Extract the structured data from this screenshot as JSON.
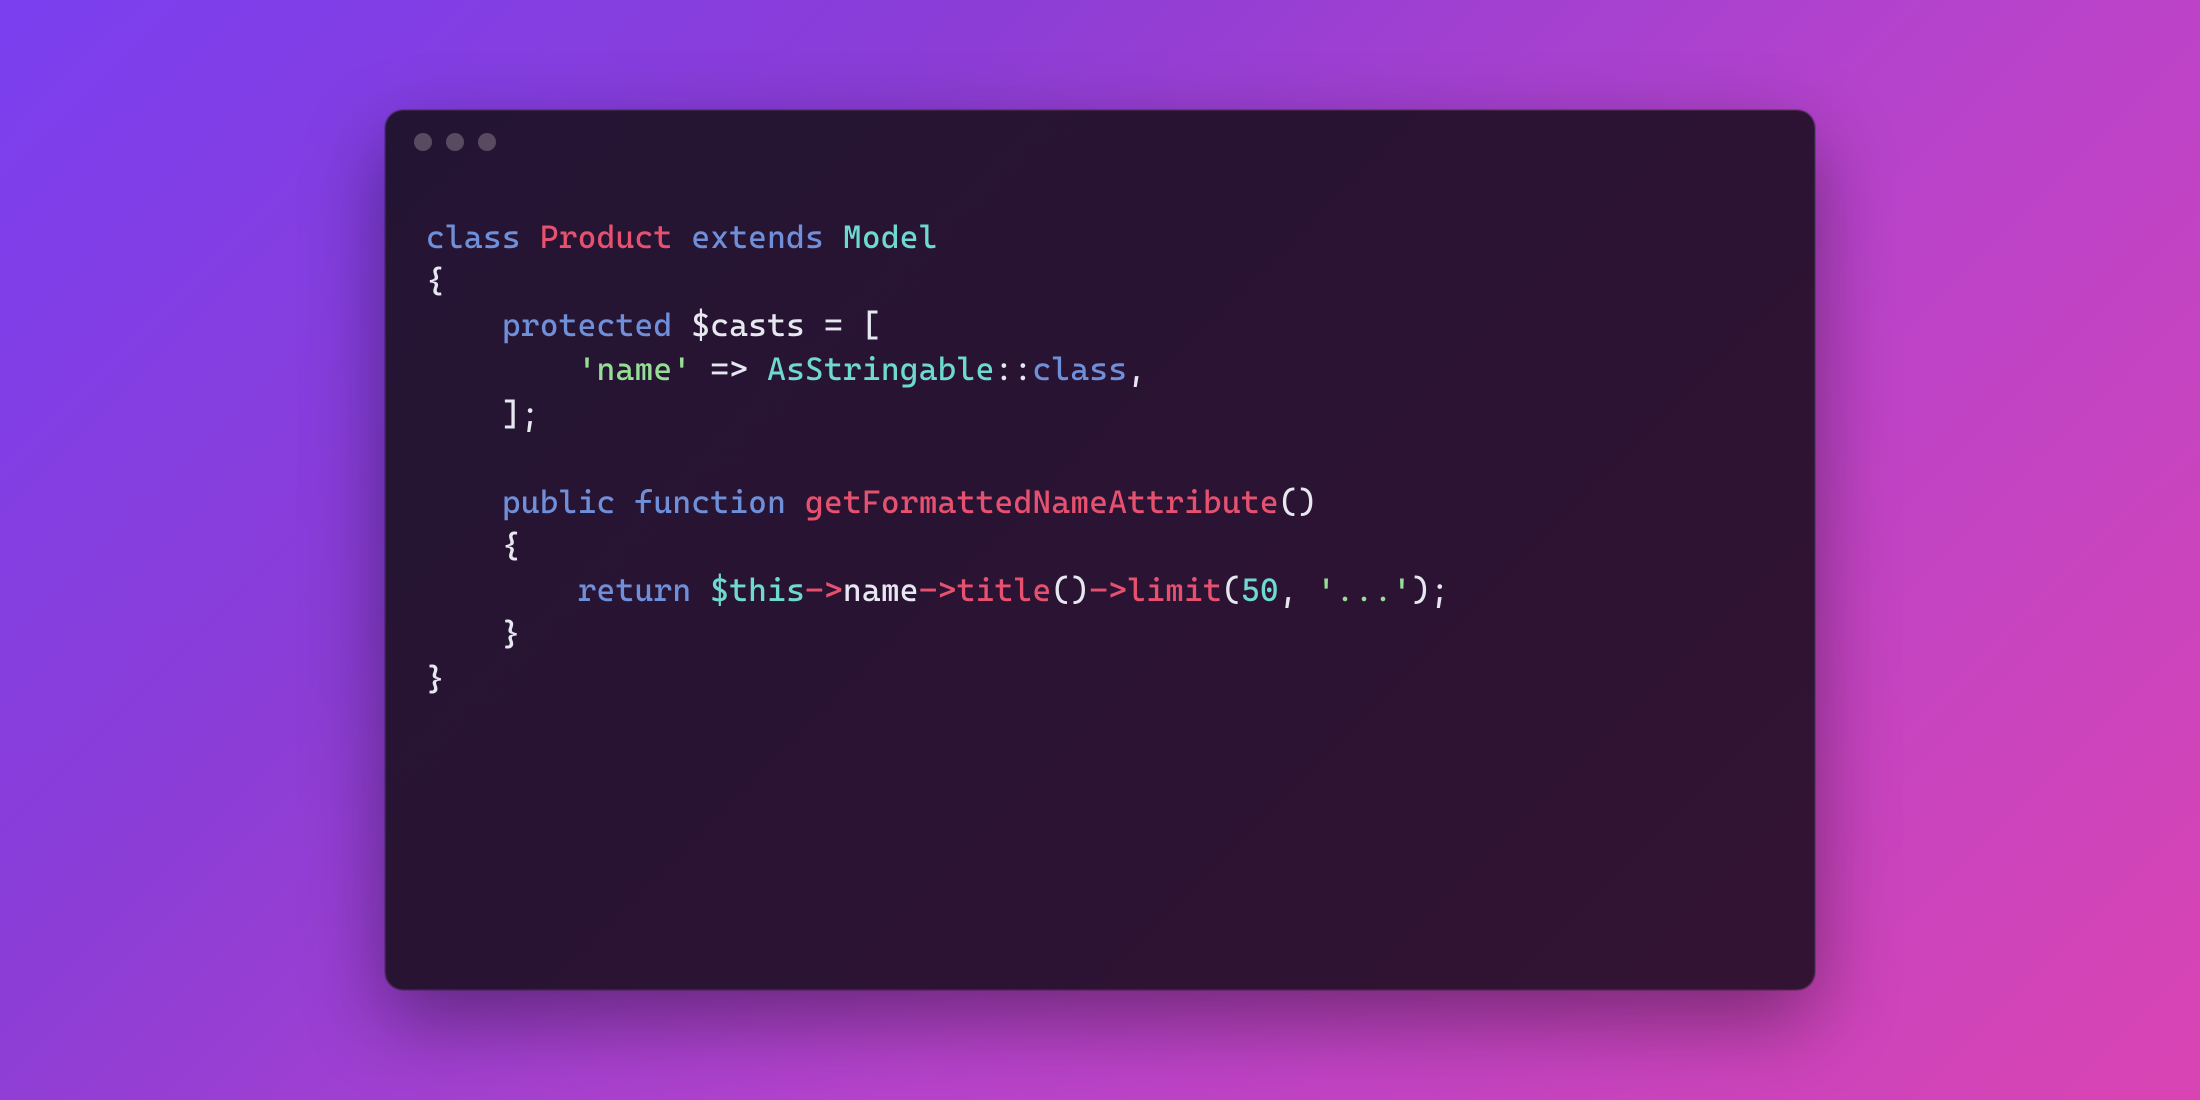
{
  "code": {
    "tokens": [
      [
        {
          "t": "class ",
          "c": "kw"
        },
        {
          "t": "Product ",
          "c": "cls"
        },
        {
          "t": "extends ",
          "c": "kw"
        },
        {
          "t": "Model",
          "c": "type"
        }
      ],
      [
        {
          "t": "{",
          "c": "pun"
        }
      ],
      [
        {
          "t": "    ",
          "c": "pun"
        },
        {
          "t": "protected ",
          "c": "kw"
        },
        {
          "t": "$casts",
          "c": "var"
        },
        {
          "t": " = [",
          "c": "pun"
        }
      ],
      [
        {
          "t": "        ",
          "c": "pun"
        },
        {
          "t": "'name'",
          "c": "str"
        },
        {
          "t": " => ",
          "c": "pun"
        },
        {
          "t": "AsStringable",
          "c": "type"
        },
        {
          "t": "::",
          "c": "pun"
        },
        {
          "t": "class",
          "c": "kw"
        },
        {
          "t": ",",
          "c": "pun"
        }
      ],
      [
        {
          "t": "    ];",
          "c": "pun"
        }
      ],
      [
        {
          "t": "",
          "c": "pun"
        }
      ],
      [
        {
          "t": "    ",
          "c": "pun"
        },
        {
          "t": "public ",
          "c": "kw"
        },
        {
          "t": "function ",
          "c": "kw"
        },
        {
          "t": "getFormattedNameAttribute",
          "c": "fn"
        },
        {
          "t": "()",
          "c": "pun"
        }
      ],
      [
        {
          "t": "    {",
          "c": "pun"
        }
      ],
      [
        {
          "t": "        ",
          "c": "pun"
        },
        {
          "t": "return ",
          "c": "kw"
        },
        {
          "t": "$this",
          "c": "thisv"
        },
        {
          "t": "->",
          "c": "arrow"
        },
        {
          "t": "name",
          "c": "prop"
        },
        {
          "t": "->",
          "c": "arrow"
        },
        {
          "t": "title",
          "c": "call"
        },
        {
          "t": "()",
          "c": "pun"
        },
        {
          "t": "->",
          "c": "arrow"
        },
        {
          "t": "limit",
          "c": "call"
        },
        {
          "t": "(",
          "c": "pun"
        },
        {
          "t": "50",
          "c": "num"
        },
        {
          "t": ", ",
          "c": "pun"
        },
        {
          "t": "'...'",
          "c": "str"
        },
        {
          "t": ");",
          "c": "pun"
        }
      ],
      [
        {
          "t": "    }",
          "c": "pun"
        }
      ],
      [
        {
          "t": "}",
          "c": "pun"
        }
      ]
    ]
  }
}
